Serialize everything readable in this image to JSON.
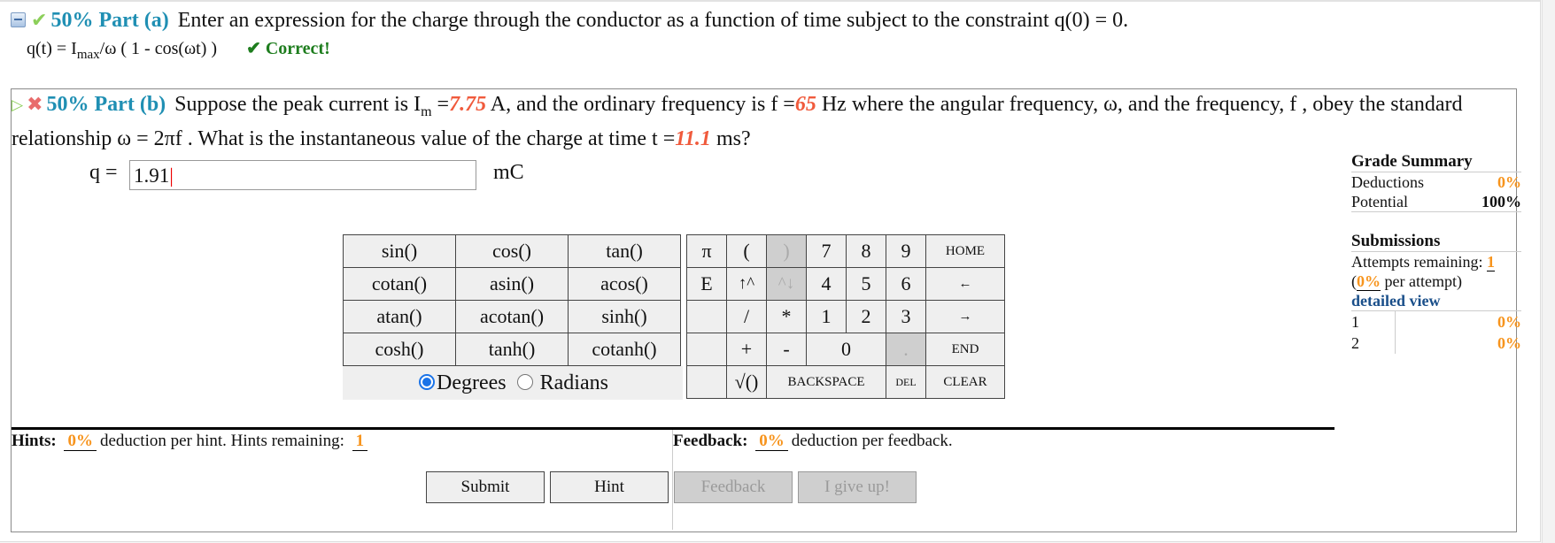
{
  "part_a": {
    "weight": "50%",
    "label": "Part (a)",
    "prompt": "Enter an expression for the charge through the conductor as a function of time subject to the constraint q(0) = 0.",
    "answer_prefix": "q(t) = I",
    "answer_sub": "max",
    "answer_suffix": "/ω ( 1 - cos(ωt) )",
    "status": "✔ Correct!",
    "icons": [
      "collapse-icon",
      "check-icon"
    ]
  },
  "part_b": {
    "weight": "50%",
    "label": "Part (b)",
    "prompt_1": "Suppose the peak current is I",
    "prompt_sub": "m",
    "prompt_2": " =",
    "peak_current": "7.75",
    "prompt_3": " A, and the ordinary frequency is f =",
    "frequency": "65",
    "prompt_4": " Hz where the angular frequency, ω, and the frequency, f , obey the standard relationship ω = 2πf . What is the instantaneous value of the charge at time t =",
    "time": "11.1",
    "prompt_5": " ms?",
    "icons": [
      "expand-icon",
      "incorrect-icon"
    ],
    "input_label": "q =",
    "input_value": "1.91",
    "unit": "mC"
  },
  "function_keys": [
    [
      "sin()",
      "cos()",
      "tan()"
    ],
    [
      "cotan()",
      "asin()",
      "acos()"
    ],
    [
      "atan()",
      "acotan()",
      "sinh()"
    ],
    [
      "cosh()",
      "tanh()",
      "cotanh()"
    ]
  ],
  "angle_mode": {
    "degrees": "Degrees",
    "radians": "Radians",
    "selected": "Degrees"
  },
  "numpad": {
    "pi": "π",
    "e": "E",
    "lparen": "(",
    "rparen": ")",
    "up": "↑^",
    "down": "^↓",
    "divide": "/",
    "multiply": "*",
    "plus": "+",
    "minus": "-",
    "sqrt": "√()",
    "d7": "7",
    "d8": "8",
    "d9": "9",
    "d4": "4",
    "d5": "5",
    "d6": "6",
    "d1": "1",
    "d2": "2",
    "d3": "3",
    "d0": "0",
    "dot": ".",
    "home": "HOME",
    "left": "←",
    "right": "→",
    "end": "END",
    "backspace": "BACKSPACE",
    "del": "DEL",
    "clear": "CLEAR"
  },
  "actions": {
    "submit": "Submit",
    "hint": "Hint",
    "feedback": "Feedback",
    "give_up": "I give up!"
  },
  "hints": {
    "label": "Hints:",
    "deduction": "0%",
    "text": "deduction per hint. Hints remaining:",
    "remaining": "1"
  },
  "feedback": {
    "label": "Feedback:",
    "deduction": "0%",
    "text": "deduction per feedback."
  },
  "grade_summary": {
    "title": "Grade Summary",
    "deductions_label": "Deductions",
    "deductions_value": "0%",
    "potential_label": "Potential",
    "potential_value": "100%"
  },
  "submissions": {
    "title": "Submissions",
    "attempts_label": "Attempts remaining:",
    "attempts_value": "1",
    "per_attempt_open": "(",
    "per_attempt_value": "0%",
    "per_attempt_text": " per attempt)",
    "detailed_view": "detailed view",
    "rows": [
      {
        "n": "1",
        "value": "0%"
      },
      {
        "n": "2",
        "value": "0%"
      }
    ]
  },
  "colors": {
    "accent_blue": "#1f8fb3",
    "given_red": "#f05a3c",
    "orange": "#f7941d",
    "correct_green": "#1e7d1e",
    "link_blue": "#1a4f8a"
  }
}
